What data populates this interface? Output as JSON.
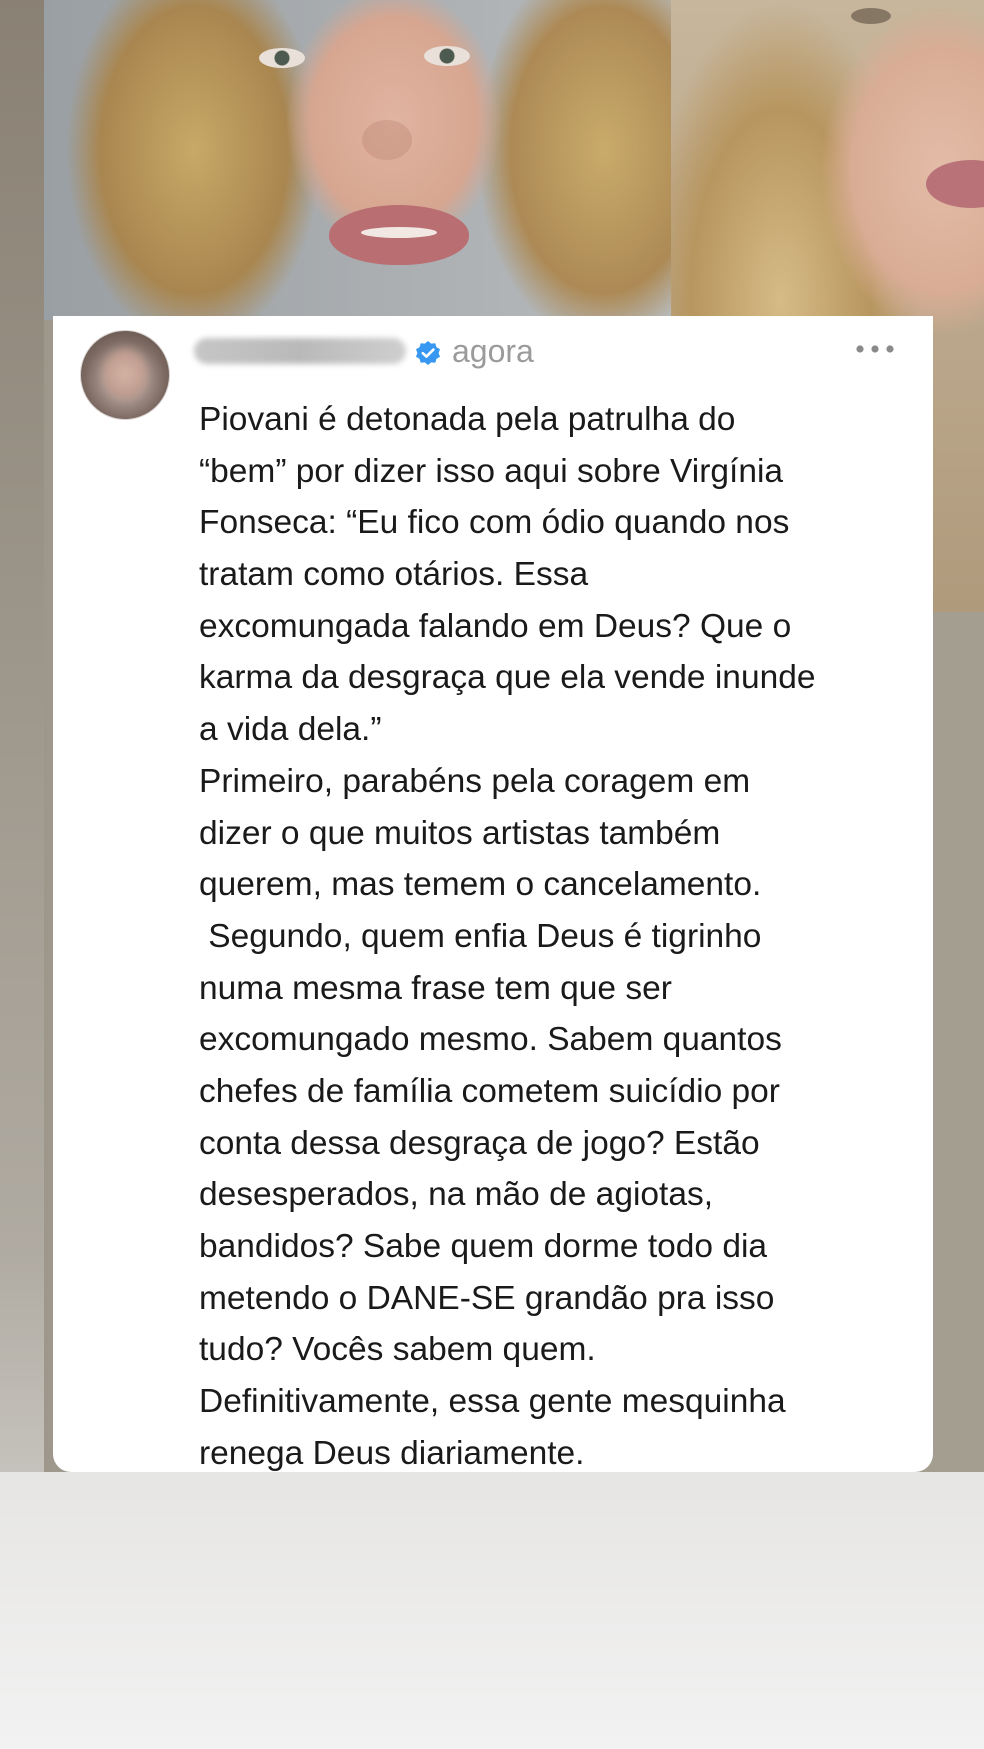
{
  "story": {
    "photos": [
      {
        "description_icon": "photo-left"
      },
      {
        "description_icon": "photo-right"
      }
    ]
  },
  "comment": {
    "username": "",
    "verified_icon": "verified-badge-icon",
    "timestamp": "agora",
    "more_icon": "more-options-icon",
    "lines": [
      "Piovani é detonada pela patrulha do",
      "“bem” por dizer isso aqui sobre Virgínia",
      "Fonseca: “Eu fico com ódio quando nos",
      "tratam como otários. Essa",
      "excomungada falando em Deus? Que o",
      "karma da desgraça que ela vende inunde",
      "a vida dela.”",
      "Primeiro, parabéns pela coragem em",
      "dizer o que muitos artistas também",
      "querem, mas temem o cancelamento.",
      " Segundo, quem enfia Deus é tigrinho",
      "numa mesma frase tem que ser",
      "excomungado mesmo. Sabem quantos",
      "chefes de família cometem suicídio por",
      "conta dessa desgraça de jogo? Estão",
      "desesperados, na mão de agiotas,",
      "bandidos? Sabe quem dorme todo dia",
      "metendo o DANE-SE grandão pra isso",
      "tudo? Vocês sabem quem.",
      "Definitivamente, essa gente mesquinha",
      "renega Deus diariamente."
    ]
  },
  "colors": {
    "verified_blue": "#3897f0",
    "timestamp_gray": "#9b9b9b",
    "text": "#1a1a1a"
  }
}
